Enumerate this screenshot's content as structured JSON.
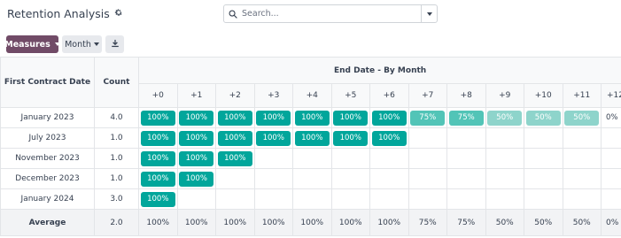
{
  "header": {
    "title": "Retention Analysis",
    "search_placeholder": "Search..."
  },
  "toolbar": {
    "measures_label": "Measures",
    "month_label": "Month"
  },
  "table": {
    "row_header": "First Contract Date",
    "count_header": "Count",
    "group_header": "End Date - By Month",
    "columns": [
      "+0",
      "+1",
      "+2",
      "+3",
      "+4",
      "+5",
      "+6",
      "+7",
      "+8",
      "+9",
      "+10",
      "+11",
      "+12"
    ],
    "rows": [
      {
        "label": "January 2023",
        "count": "4.0",
        "cells": [
          "100%",
          "100%",
          "100%",
          "100%",
          "100%",
          "100%",
          "100%",
          "75%",
          "75%",
          "50%",
          "50%",
          "50%",
          "0%"
        ]
      },
      {
        "label": "July 2023",
        "count": "1.0",
        "cells": [
          "100%",
          "100%",
          "100%",
          "100%",
          "100%",
          "100%",
          "100%",
          "",
          "",
          "",
          "",
          "",
          ""
        ]
      },
      {
        "label": "November 2023",
        "count": "1.0",
        "cells": [
          "100%",
          "100%",
          "100%",
          "",
          "",
          "",
          "",
          "",
          "",
          "",
          "",
          "",
          ""
        ]
      },
      {
        "label": "December 2023",
        "count": "1.0",
        "cells": [
          "100%",
          "100%",
          "",
          "",
          "",
          "",
          "",
          "",
          "",
          "",
          "",
          "",
          ""
        ]
      },
      {
        "label": "January 2024",
        "count": "3.0",
        "cells": [
          "100%",
          "",
          "",
          "",
          "",
          "",
          "",
          "",
          "",
          "",
          "",
          "",
          ""
        ]
      }
    ],
    "average": {
      "label": "Average",
      "count": "2.0",
      "cells": [
        "100%",
        "100%",
        "100%",
        "100%",
        "100%",
        "100%",
        "100%",
        "75%",
        "75%",
        "50%",
        "50%",
        "50%",
        "0%"
      ]
    }
  },
  "colors": {
    "brand": "#714b67",
    "chip_full": "#01a69b",
    "chip_75": "#52c4b7",
    "chip_50": "#8ed4cb"
  },
  "icons": [
    "gear-icon",
    "search-icon",
    "caret-down-icon",
    "download-icon"
  ]
}
